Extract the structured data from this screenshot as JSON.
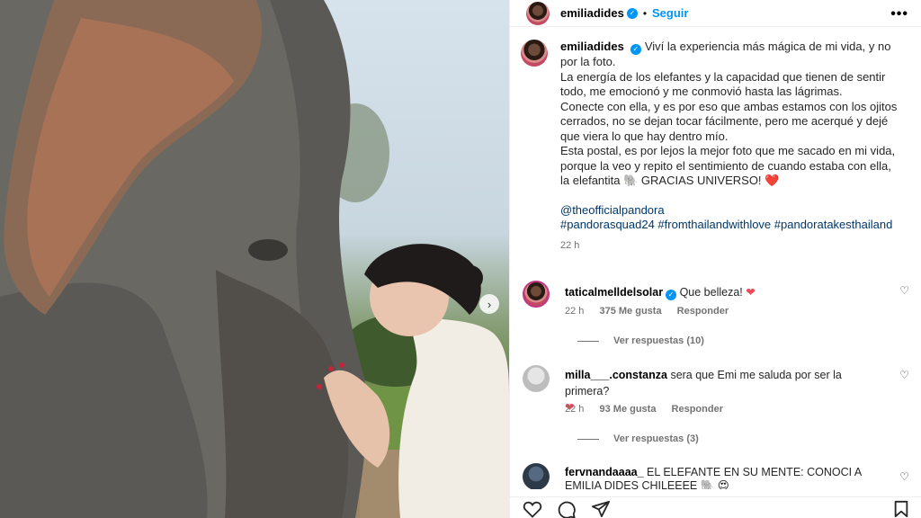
{
  "post": {
    "author": "emiliadides",
    "follow_label": "Seguir",
    "more_label": "•••",
    "separator": "•"
  },
  "caption": {
    "author": "emiliadides",
    "lines": [
      "Viví la experiencia más mágica de mi vida, y no por la foto.",
      "La energía de los elefantes y la capacidad que tienen de sentir todo, me emocionó y me conmovió hasta las lágrimas.",
      "Conecte con ella, y es por eso que ambas estamos con los ojitos cerrados, no se dejan tocar fácilmente, pero me acerqué y dejé que viera lo que hay dentro mío.",
      "Esta postal, es por lejos la mejor foto que me sacado en mi vida, porque la veo y repito el sentimiento de cuando estaba con ella, la elefantita 🐘 GRACIAS UNIVERSO! ❤️"
    ],
    "mention": "@theofficialpandora",
    "hashtags": "#pandorasquad24 #fromthailandwithlove #pandoratakesthailand",
    "time": "22 h"
  },
  "comments": [
    {
      "user": "taticalmelldelsolar",
      "text": "Que belleza!",
      "heart": "❤",
      "time": "22 h",
      "likes": "375 Me gusta",
      "reply": "Responder",
      "view_replies": "Ver respuestas (10)"
    },
    {
      "user": "milla___.constanza",
      "text": "sera que Emi me saluda por ser la primera?",
      "heart": "❤",
      "time": "22 h",
      "likes": "93 Me gusta",
      "reply": "Responder",
      "view_replies": "Ver respuestas (3)"
    },
    {
      "user": "fervnandaaaa_",
      "text": "EL ELEFANTE EN SU MENTE: CONOCI A EMILIA DIDES CHILEEEE 🐘 😍"
    }
  ],
  "icons": {
    "heart": "heart-icon",
    "comment": "comment-icon",
    "share": "share-icon",
    "save": "bookmark-icon",
    "next": "chevron-right-icon",
    "verified": "verified-badge-icon"
  },
  "colors": {
    "link": "#0095f6",
    "hashtag": "#00376b",
    "muted": "#737373",
    "like_red": "#ed4956"
  }
}
